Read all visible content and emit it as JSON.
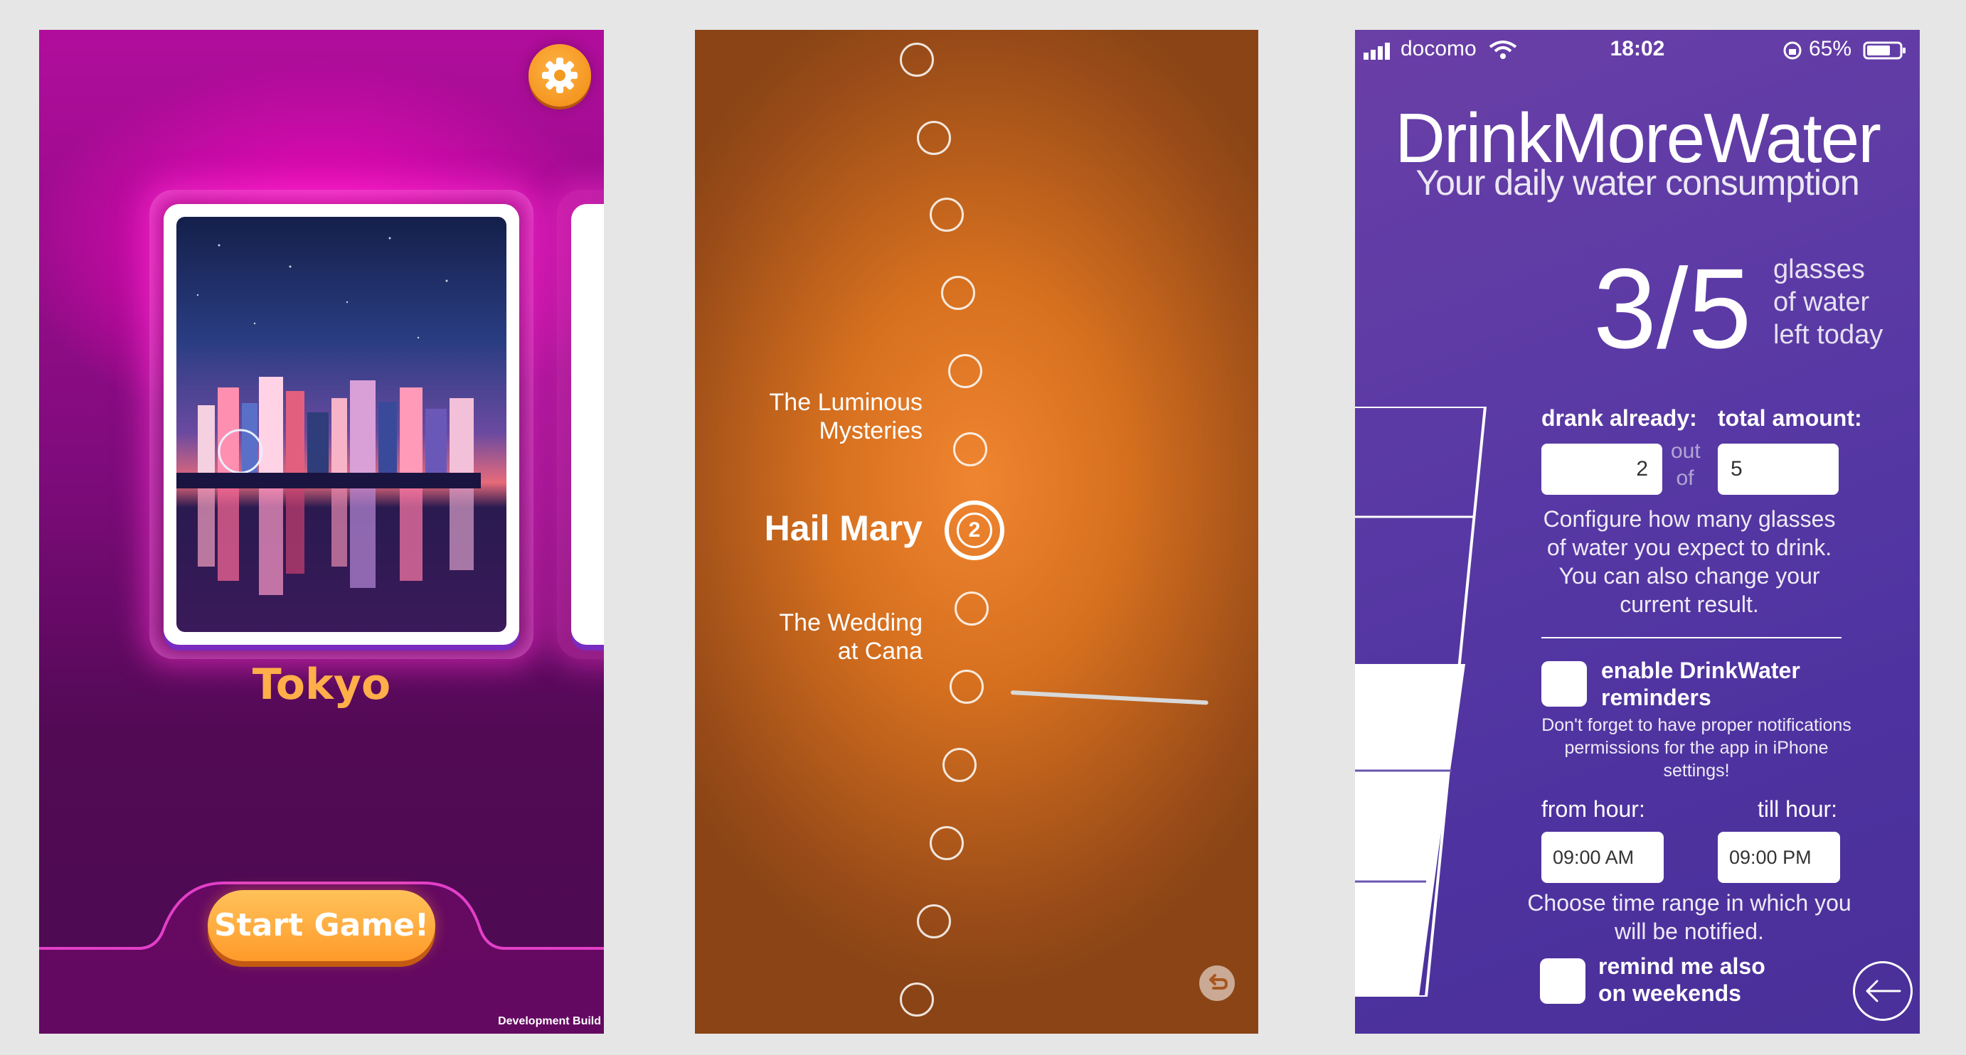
{
  "tokyo_game": {
    "city_name": "Tokyo",
    "start_button_label": "Start Game!",
    "footer_text": "Development Build"
  },
  "rosary": {
    "mystery_prev": [
      "The Luminous",
      "Mysteries"
    ],
    "current_prayer": "Hail Mary",
    "current_count": "2",
    "mystery_next": [
      "The Wedding",
      "at Cana"
    ]
  },
  "water_app": {
    "status": {
      "carrier": "docomo",
      "time": "18:02",
      "battery": "65%"
    },
    "title": "DrinkMoreWater",
    "subtitle": "Your daily water consumption",
    "progress": {
      "remaining": 3,
      "total": 5,
      "display": "3/5",
      "label_lines": [
        "glasses",
        "of water",
        "left today"
      ]
    },
    "drank_label": "drank already:",
    "total_label": "total amount:",
    "drank_value": "2",
    "out_word": "out",
    "of_word": "of",
    "total_value": "5",
    "configure_help": "Configure how many glasses of water you expect to drink. You can also change your current result.",
    "reminders_label_lines": [
      "enable DrinkWater",
      "reminders"
    ],
    "reminders_checked": false,
    "permissions_note": "Don't forget to have proper notifications permissions for the app in iPhone settings!",
    "from_hour_label": "from hour:",
    "till_hour_label": "till hour:",
    "from_hour_value": "09:00 AM",
    "till_hour_value": "09:00 PM",
    "time_range_help": "Choose time range in which you will be notified.",
    "weekends_label_lines": [
      "remind me also",
      "on weekends"
    ],
    "weekends_checked": false,
    "accent_color": "#ffae4a",
    "rosary_color": "#e07a28",
    "water_color": "#5b3aa5"
  }
}
